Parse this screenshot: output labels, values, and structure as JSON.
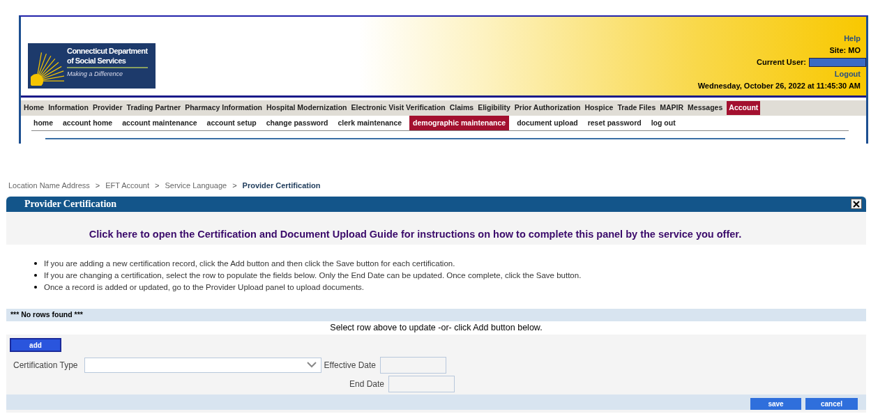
{
  "logo": {
    "line1": "Connecticut Department",
    "line2": "of Social Services",
    "tagline": "Making a Difference"
  },
  "header": {
    "help": "Help",
    "site": "Site: MO",
    "current_user_label": "Current User:",
    "logout": "Logout",
    "datetime": "Wednesday, October 26, 2022 at 11:45:30 AM"
  },
  "main_menu": [
    {
      "label": "Home",
      "selected": false
    },
    {
      "label": "Information",
      "selected": false
    },
    {
      "label": "Provider",
      "selected": false
    },
    {
      "label": "Trading Partner",
      "selected": false
    },
    {
      "label": "Pharmacy Information",
      "selected": false
    },
    {
      "label": "Hospital Modernization",
      "selected": false
    },
    {
      "label": "Electronic Visit Verification",
      "selected": false
    },
    {
      "label": "Claims",
      "selected": false
    },
    {
      "label": "Eligibility",
      "selected": false
    },
    {
      "label": "Prior Authorization",
      "selected": false
    },
    {
      "label": "Hospice",
      "selected": false
    },
    {
      "label": "Trade Files",
      "selected": false
    },
    {
      "label": "MAPIR",
      "selected": false
    },
    {
      "label": "Messages",
      "selected": false
    },
    {
      "label": "Account",
      "selected": true
    }
  ],
  "sub_menu": [
    {
      "label": "home",
      "selected": false
    },
    {
      "label": "account home",
      "selected": false
    },
    {
      "label": "account maintenance",
      "selected": false
    },
    {
      "label": "account setup",
      "selected": false
    },
    {
      "label": "change password",
      "selected": false
    },
    {
      "label": "clerk maintenance",
      "selected": false
    },
    {
      "label": "demographic maintenance",
      "selected": true
    },
    {
      "label": "document upload",
      "selected": false
    },
    {
      "label": "reset password",
      "selected": false
    },
    {
      "label": "log out",
      "selected": false
    }
  ],
  "breadcrumb": [
    {
      "label": "Location Name Address",
      "current": false
    },
    {
      "label": "EFT Account",
      "current": false
    },
    {
      "label": "Service Language",
      "current": false
    },
    {
      "label": "Provider Certification",
      "current": true
    }
  ],
  "breadcrumb_separator": ">",
  "panel": {
    "title": "Provider Certification",
    "guide_link": "Click here to open the Certification and Document Upload Guide for instructions on how to complete this panel by the service you offer.",
    "instructions": [
      "If you are adding a new certification record, click the Add button and then click the Save button for each certification.",
      "If you are changing a certification, select the row to populate the fields below. Only the End Date can be updated. Once complete, click the Save button.",
      "Once a record is added or updated, go to the Provider Upload panel to upload documents."
    ],
    "no_rows": "*** No rows found ***",
    "select_hint": "Select row above to update -or- click Add button below.",
    "add_button": "add",
    "certification_type_label": "Certification Type",
    "effective_date_label": "Effective Date",
    "end_date_label": "End Date",
    "save_button": "save",
    "cancel_button": "cancel"
  }
}
